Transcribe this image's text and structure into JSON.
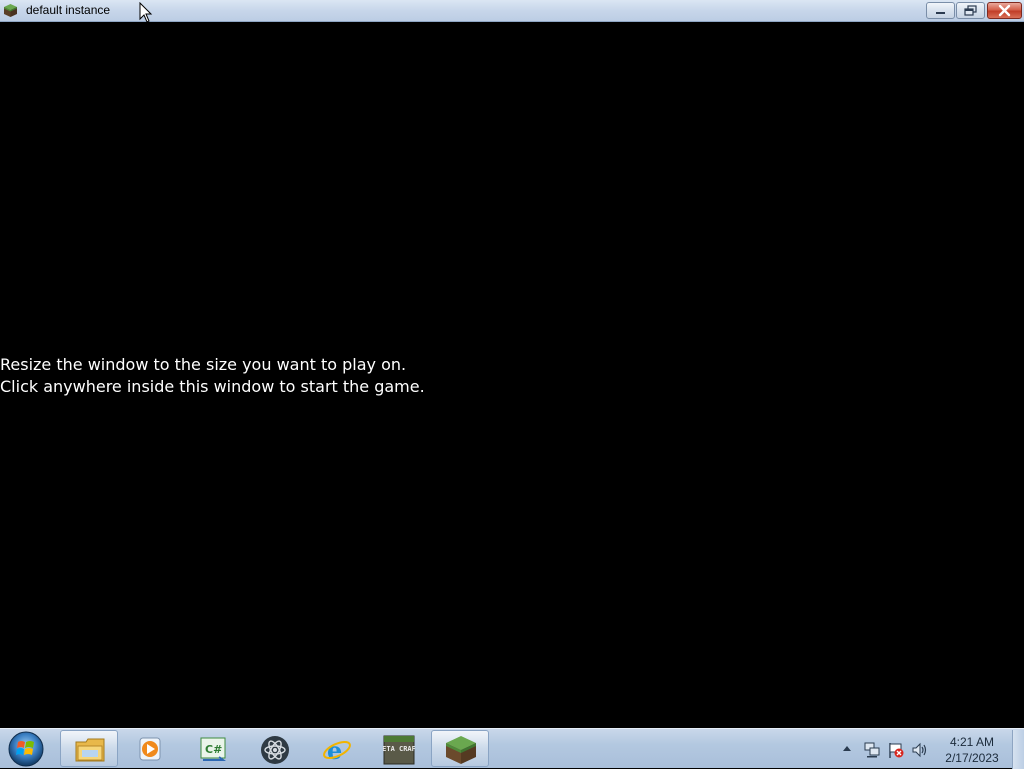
{
  "window": {
    "title": "default instance",
    "icon": "minecraft-grass-block-icon",
    "controls": {
      "minimize": "minimize-icon",
      "maximize": "restore-icon",
      "close": "close-icon"
    }
  },
  "game": {
    "message_line1": "Resize the window to the size you want to play on.",
    "message_line2": "Click anywhere inside this window to start the game."
  },
  "taskbar": {
    "start_icon": "windows-start-orb-icon",
    "pinned": [
      {
        "name": "file-explorer-icon",
        "active": true
      },
      {
        "name": "media-player-icon",
        "active": false
      },
      {
        "name": "csharp-editor-icon",
        "active": false
      },
      {
        "name": "atom-icon",
        "active": false
      },
      {
        "name": "internet-explorer-icon",
        "active": false
      },
      {
        "name": "betacraft-icon",
        "active": false
      },
      {
        "name": "minecraft-grass-block-icon",
        "active": true
      }
    ],
    "betacraft_label": "BETA CRAFT",
    "tray": {
      "expand_icon": "tray-expand-arrow-icon",
      "icons": [
        "network-icon",
        "action-center-flag-icon",
        "volume-icon"
      ]
    },
    "clock": {
      "time": "4:21 AM",
      "date": "2/17/2023"
    }
  },
  "colors": {
    "window_bg": "#000000",
    "message_text": "#ffffff",
    "taskbar": "#b3c8e0",
    "close_button": "#c13e28"
  }
}
